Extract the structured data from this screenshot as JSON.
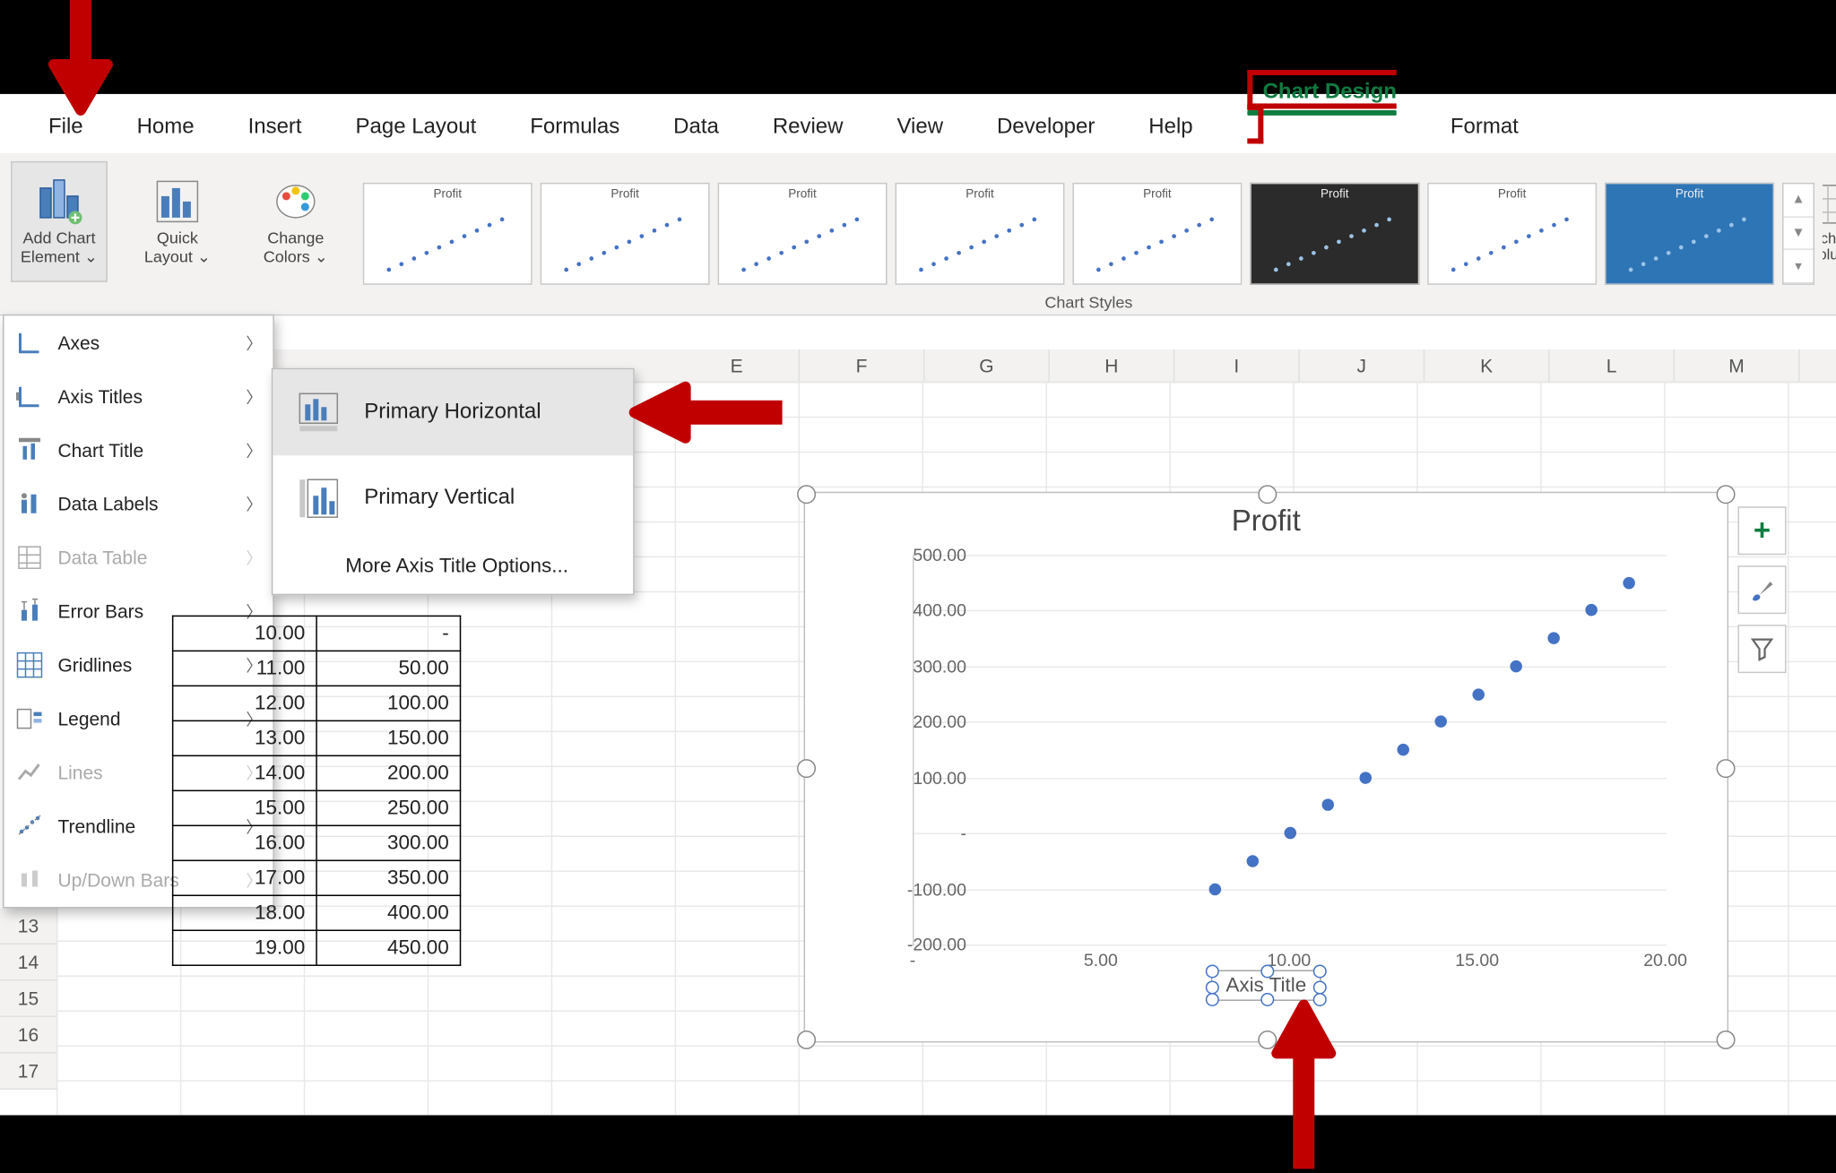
{
  "tabs": {
    "file": "File",
    "home": "Home",
    "insert": "Insert",
    "pagelayout": "Page Layout",
    "formulas": "Formulas",
    "data": "Data",
    "review": "Review",
    "view": "View",
    "developer": "Developer",
    "help": "Help",
    "chartdesign": "Chart Design",
    "format": "Format"
  },
  "ribbon": {
    "add_chart_element": "Add Chart\nElement ⌄",
    "quick_layout": "Quick\nLayout ⌄",
    "change_colors": "Change\nColors ⌄",
    "chart_styles_label": "Chart Styles",
    "style_title": "Profit",
    "switch": "Switch Row/\nColumn"
  },
  "menu1": {
    "axes": "Axes",
    "axis_titles": "Axis Titles",
    "chart_title": "Chart Title",
    "data_labels": "Data Labels",
    "data_table": "Data Table",
    "error_bars": "Error Bars",
    "gridlines": "Gridlines",
    "legend": "Legend",
    "lines": "Lines",
    "trendline": "Trendline",
    "updown": "Up/Down Bars"
  },
  "menu2": {
    "ph": "Primary Horizontal",
    "pv": "Primary Vertical",
    "more": "More Axis Title Options..."
  },
  "columns": [
    "E",
    "F",
    "G",
    "H",
    "I",
    "J",
    "K",
    "L",
    "M"
  ],
  "rows_visible": [
    "13",
    "14",
    "15",
    "16",
    "17"
  ],
  "table": [
    [
      "10.00",
      "-"
    ],
    [
      "11.00",
      "50.00"
    ],
    [
      "12.00",
      "100.00"
    ],
    [
      "13.00",
      "150.00"
    ],
    [
      "14.00",
      "200.00"
    ],
    [
      "15.00",
      "250.00"
    ],
    [
      "16.00",
      "300.00"
    ],
    [
      "17.00",
      "350.00"
    ],
    [
      "18.00",
      "400.00"
    ],
    [
      "19.00",
      "450.00"
    ]
  ],
  "chart": {
    "title": "Profit",
    "axis_title_placeholder": "Axis Title",
    "yticks": [
      "500.00",
      "400.00",
      "300.00",
      "200.00",
      "100.00",
      "-",
      "-100.00",
      "-200.00"
    ],
    "xticks": [
      "-",
      "5.00",
      "10.00",
      "15.00",
      "20.00"
    ]
  },
  "chart_data": {
    "type": "scatter",
    "title": "Profit",
    "xlabel": "Axis Title",
    "ylabel": "",
    "xlim": [
      0,
      20
    ],
    "ylim": [
      -200,
      500
    ],
    "x": [
      8,
      9,
      10,
      11,
      12,
      13,
      14,
      15,
      16,
      17,
      18,
      19
    ],
    "y": [
      -100,
      -50,
      0,
      50,
      100,
      150,
      200,
      250,
      300,
      350,
      400,
      450
    ]
  }
}
